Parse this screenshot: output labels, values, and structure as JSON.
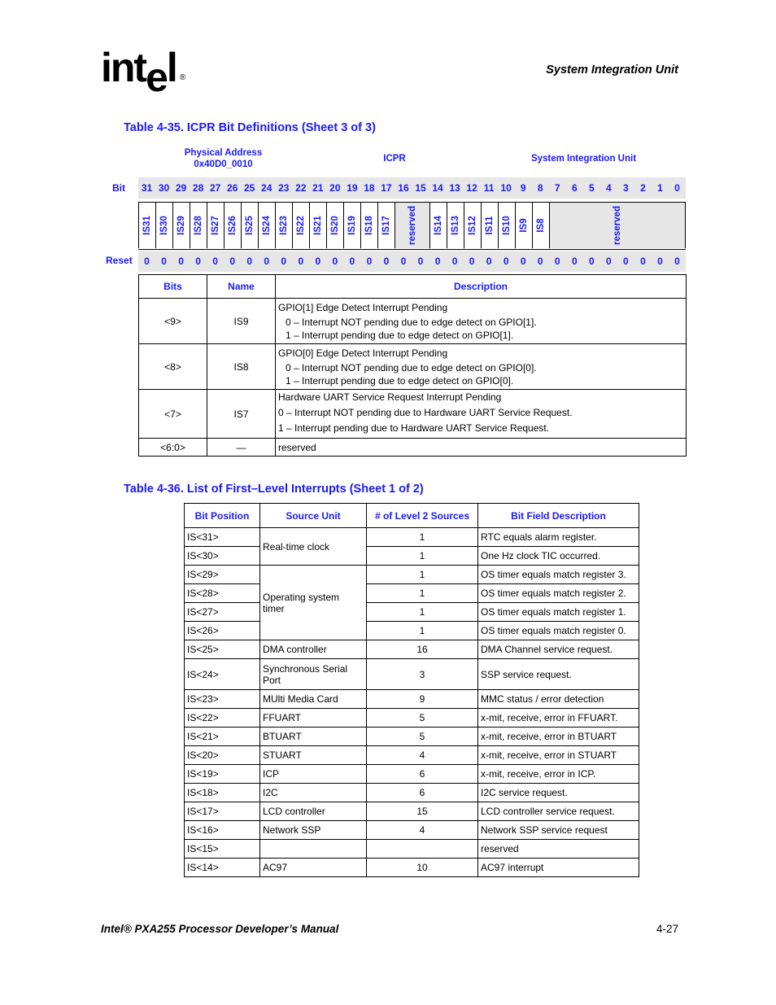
{
  "header": {
    "logo": "intel",
    "section_title": "System Integration Unit"
  },
  "table1": {
    "caption": "Table 4-35. ICPR Bit Definitions (Sheet 3 of 3)",
    "physical_address_label": "Physical Address",
    "physical_address": "0x40D0_0010",
    "register_name": "ICPR",
    "unit_name": "System Integration Unit",
    "bit_label": "Bit",
    "reset_label": "Reset",
    "bits": [
      "31",
      "30",
      "29",
      "28",
      "27",
      "26",
      "25",
      "24",
      "23",
      "22",
      "21",
      "20",
      "19",
      "18",
      "17",
      "16",
      "15",
      "14",
      "13",
      "12",
      "11",
      "10",
      "9",
      "8",
      "7",
      "6",
      "5",
      "4",
      "3",
      "2",
      "1",
      "0"
    ],
    "fields": [
      {
        "name": "IS31",
        "span": 1,
        "reserved": false
      },
      {
        "name": "IS30",
        "span": 1,
        "reserved": false
      },
      {
        "name": "IS29",
        "span": 1,
        "reserved": false
      },
      {
        "name": "IS28",
        "span": 1,
        "reserved": false
      },
      {
        "name": "IS27",
        "span": 1,
        "reserved": false
      },
      {
        "name": "IS26",
        "span": 1,
        "reserved": false
      },
      {
        "name": "IS25",
        "span": 1,
        "reserved": false
      },
      {
        "name": "IS24",
        "span": 1,
        "reserved": false
      },
      {
        "name": "IS23",
        "span": 1,
        "reserved": false
      },
      {
        "name": "IS22",
        "span": 1,
        "reserved": false
      },
      {
        "name": "IS21",
        "span": 1,
        "reserved": false
      },
      {
        "name": "IS20",
        "span": 1,
        "reserved": false
      },
      {
        "name": "IS19",
        "span": 1,
        "reserved": false
      },
      {
        "name": "IS18",
        "span": 1,
        "reserved": false
      },
      {
        "name": "IS17",
        "span": 1,
        "reserved": false
      },
      {
        "name": "reserved",
        "span": 2,
        "reserved": true
      },
      {
        "name": "IS14",
        "span": 1,
        "reserved": false
      },
      {
        "name": "IS13",
        "span": 1,
        "reserved": false
      },
      {
        "name": "IS12",
        "span": 1,
        "reserved": false
      },
      {
        "name": "IS11",
        "span": 1,
        "reserved": false
      },
      {
        "name": "IS10",
        "span": 1,
        "reserved": false
      },
      {
        "name": "IS9",
        "span": 1,
        "reserved": false
      },
      {
        "name": "IS8",
        "span": 1,
        "reserved": false
      },
      {
        "name": "reserved",
        "span": 8,
        "reserved": true
      }
    ],
    "reset_values": [
      "0",
      "0",
      "0",
      "0",
      "0",
      "0",
      "0",
      "0",
      "0",
      "0",
      "0",
      "0",
      "0",
      "0",
      "0",
      "0",
      "0",
      "0",
      "0",
      "0",
      "0",
      "0",
      "0",
      "0",
      "0",
      "0",
      "0",
      "0",
      "0",
      "0",
      "0",
      "0"
    ],
    "columns": {
      "bits": "Bits",
      "name": "Name",
      "description": "Description"
    },
    "rows": [
      {
        "bits": "<9>",
        "name": "IS9",
        "title": "GPIO[1] Edge Detect Interrupt Pending",
        "lines": [
          "0 –  Interrupt NOT pending due to edge detect on GPIO[1].",
          "1 –  Interrupt pending due to edge detect on GPIO[1]."
        ]
      },
      {
        "bits": "<8>",
        "name": "IS8",
        "title": "GPIO[0] Edge Detect Interrupt Pending",
        "lines": [
          "0 –  Interrupt NOT pending due to edge detect on GPIO[0].",
          "1 –  Interrupt pending due to edge detect on GPIO[0]."
        ]
      },
      {
        "bits": "<7>",
        "name": "IS7",
        "title": "Hardware UART Service Request Interrupt Pending",
        "lines": [
          "0 – Interrupt NOT pending due to Hardware UART Service Request.",
          "1 – Interrupt pending due to Hardware UART Service Request."
        ]
      },
      {
        "bits": "<6:0>",
        "name": "—",
        "title": "reserved",
        "lines": []
      }
    ]
  },
  "table2": {
    "caption": "Table 4-36. List of First–Level Interrupts (Sheet 1 of 2)",
    "columns": {
      "bit_position": "Bit Position",
      "source_unit": "Source Unit",
      "level2": "# of Level 2 Sources",
      "description": "Bit Field Description"
    },
    "rows": [
      {
        "bit": "IS<31>",
        "source": "Real-time clock",
        "source_rowspan": 2,
        "count": "1",
        "desc": "RTC equals alarm register."
      },
      {
        "bit": "IS<30>",
        "source": null,
        "count": "1",
        "desc": "One Hz clock TIC occurred."
      },
      {
        "bit": "IS<29>",
        "source": "Operating system timer",
        "source_rowspan": 4,
        "count": "1",
        "desc": "OS timer equals match register 3."
      },
      {
        "bit": "IS<28>",
        "source": null,
        "count": "1",
        "desc": "OS timer equals match register 2."
      },
      {
        "bit": "IS<27>",
        "source": null,
        "count": "1",
        "desc": "OS timer equals match register 1."
      },
      {
        "bit": "IS<26>",
        "source": null,
        "count": "1",
        "desc": "OS timer equals match register 0."
      },
      {
        "bit": "IS<25>",
        "source": "DMA controller",
        "source_rowspan": 1,
        "count": "16",
        "desc": "DMA Channel service request."
      },
      {
        "bit": "IS<24>",
        "source": "Synchronous Serial Port",
        "source_rowspan": 1,
        "count": "3",
        "desc": "SSP service request."
      },
      {
        "bit": "IS<23>",
        "source": "MUlti Media Card",
        "source_rowspan": 1,
        "count": "9",
        "desc": "MMC status / error detection"
      },
      {
        "bit": "IS<22>",
        "source": "FFUART",
        "source_rowspan": 1,
        "count": "5",
        "desc": "x-mit, receive, error in FFUART."
      },
      {
        "bit": "IS<21>",
        "source": "BTUART",
        "source_rowspan": 1,
        "count": "5",
        "desc": "x-mit, receive, error in BTUART"
      },
      {
        "bit": "IS<20>",
        "source": "STUART",
        "source_rowspan": 1,
        "count": "4",
        "desc": "x-mit, receive, error in STUART"
      },
      {
        "bit": "IS<19>",
        "source": "ICP",
        "source_rowspan": 1,
        "count": "6",
        "desc": "x-mit, receive, error in ICP."
      },
      {
        "bit": "IS<18>",
        "source": "I2C",
        "source_rowspan": 1,
        "count": "6",
        "desc": "I2C service request."
      },
      {
        "bit": "IS<17>",
        "source": "LCD controller",
        "source_rowspan": 1,
        "count": "15",
        "desc": "LCD controller service request."
      },
      {
        "bit": "IS<16>",
        "source": "Network SSP",
        "source_rowspan": 1,
        "count": "4",
        "desc": "Network SSP service request"
      },
      {
        "bit": "IS<15>",
        "source": "",
        "source_rowspan": 1,
        "count": "",
        "desc": "reserved"
      },
      {
        "bit": "IS<14>",
        "source": "AC97",
        "source_rowspan": 1,
        "count": "10",
        "desc": "AC97 interrupt"
      }
    ]
  },
  "footer": {
    "manual_title": "Intel® PXA255 Processor Developer’s Manual",
    "page_number": "4-27"
  }
}
